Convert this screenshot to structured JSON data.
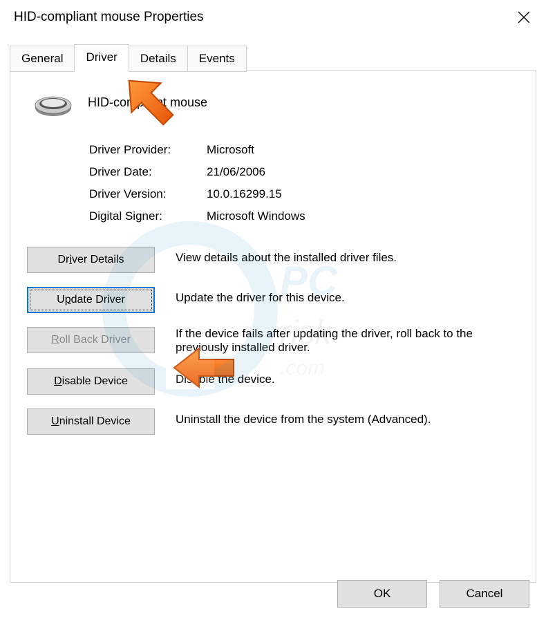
{
  "window": {
    "title": "HID-compliant mouse Properties"
  },
  "tabs": {
    "general": "General",
    "driver": "Driver",
    "details": "Details",
    "events": "Events",
    "active": "Driver"
  },
  "device": {
    "name": "HID-compliant mouse",
    "icon": "mouse-icon"
  },
  "driver_info": {
    "provider_label": "Driver Provider:",
    "provider_value": "Microsoft",
    "date_label": "Driver Date:",
    "date_value": "21/06/2006",
    "version_label": "Driver Version:",
    "version_value": "10.0.16299.15",
    "signer_label": "Digital Signer:",
    "signer_value": "Microsoft Windows"
  },
  "actions": {
    "driver_details": {
      "label_pre": "Dr",
      "accel": "i",
      "label_post": "ver Details",
      "desc": "View details about the installed driver files."
    },
    "update_driver": {
      "label_pre": "U",
      "accel": "p",
      "label_post": "date Driver",
      "desc": "Update the driver for this device."
    },
    "roll_back": {
      "label_pre": "",
      "accel": "R",
      "label_post": "oll Back Driver",
      "desc": "If the device fails after updating the driver, roll back to the previously installed driver.",
      "disabled": true
    },
    "disable": {
      "label_pre": "",
      "accel": "D",
      "label_post": "isable Device",
      "desc": "Disable the device."
    },
    "uninstall": {
      "label_pre": "",
      "accel": "U",
      "label_post": "ninstall Device",
      "desc": "Uninstall the device from the system (Advanced)."
    }
  },
  "dialog_buttons": {
    "ok": "OK",
    "cancel": "Cancel"
  },
  "annotations": {
    "arrow1": {
      "target": "tab-driver"
    },
    "arrow2": {
      "target": "update-driver-button"
    }
  },
  "watermark": "pcrisk.com"
}
